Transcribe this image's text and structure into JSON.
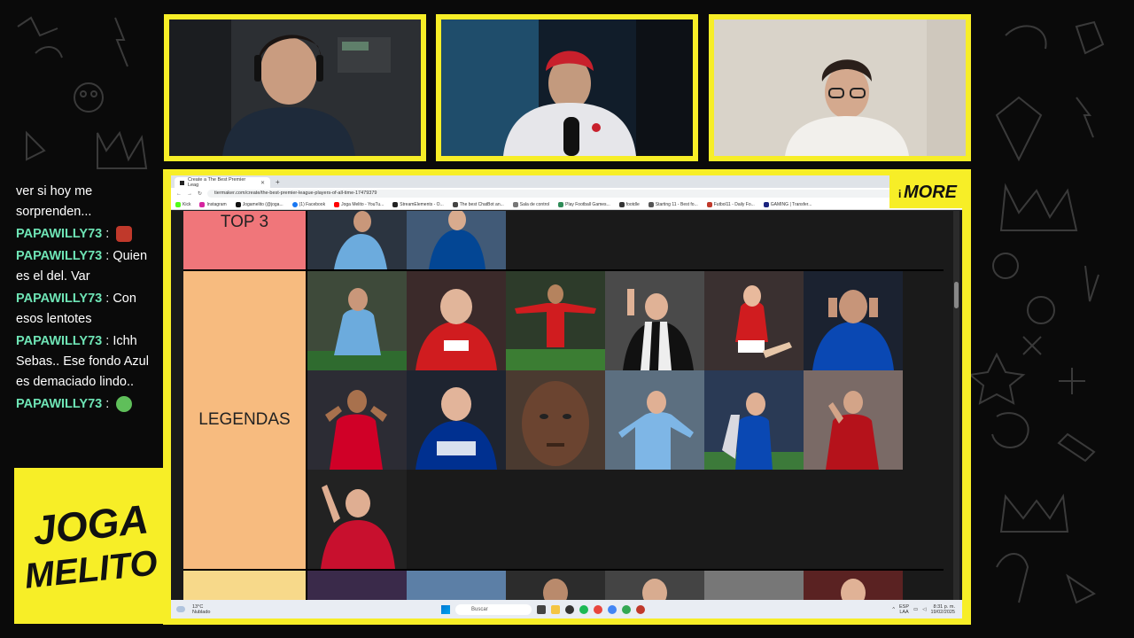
{
  "chat": {
    "messages": [
      {
        "user": "",
        "text": "ver si hoy me sorprenden..."
      },
      {
        "user": "PAPAWILLY73",
        "text": ":",
        "emote": "angry-emote"
      },
      {
        "user": "PAPAWILLY73",
        "text": ": Quien es el del. Var"
      },
      {
        "user": "PAPAWILLY73",
        "text": ": Con esos lentotes"
      },
      {
        "user": "PAPAWILLY73",
        "text": ": Ichh Sebas.. Ese fondo Azul es demaciado lindo.."
      },
      {
        "user": "PAPAWILLY73",
        "text": ":",
        "emote": "sick-emote"
      }
    ]
  },
  "brand": {
    "line1": "JOGA",
    "line2": "MELITO"
  },
  "overlay_logo": {
    "prefix": "i",
    "text": "MORE"
  },
  "browser": {
    "tab_title": "Create a The Best Premier Leag",
    "new_tab": "+",
    "url": "tiermaker.com/create/the-best-premier-league-players-of-all-time-17479379",
    "bookmarks": [
      "Kick",
      "Instagram",
      "Jogamelito (@joga...",
      "(1) Facebook",
      "Joga Melito - YouTu...",
      "StreamElements - O...",
      "The best ChatBot an...",
      "Sala de control",
      "Play Football Games...",
      "footdle",
      "Starting 11 - Best fo...",
      "Futbol11 - Daily Fo...",
      "GAMING | Transfer..."
    ]
  },
  "tiers": [
    {
      "label": "TOP 3",
      "color": "#f0767a"
    },
    {
      "label": "LEGENDAS",
      "color": "#f7bb7f"
    },
    {
      "label": "",
      "color": "#f7d98a"
    }
  ],
  "taskbar": {
    "temp": "13°C",
    "weather": "Nublado",
    "search_placeholder": "Buscar",
    "lang_1": "ESP",
    "lang_2": "LAA",
    "time": "8:31 p. m.",
    "date": "19/02/2025"
  }
}
